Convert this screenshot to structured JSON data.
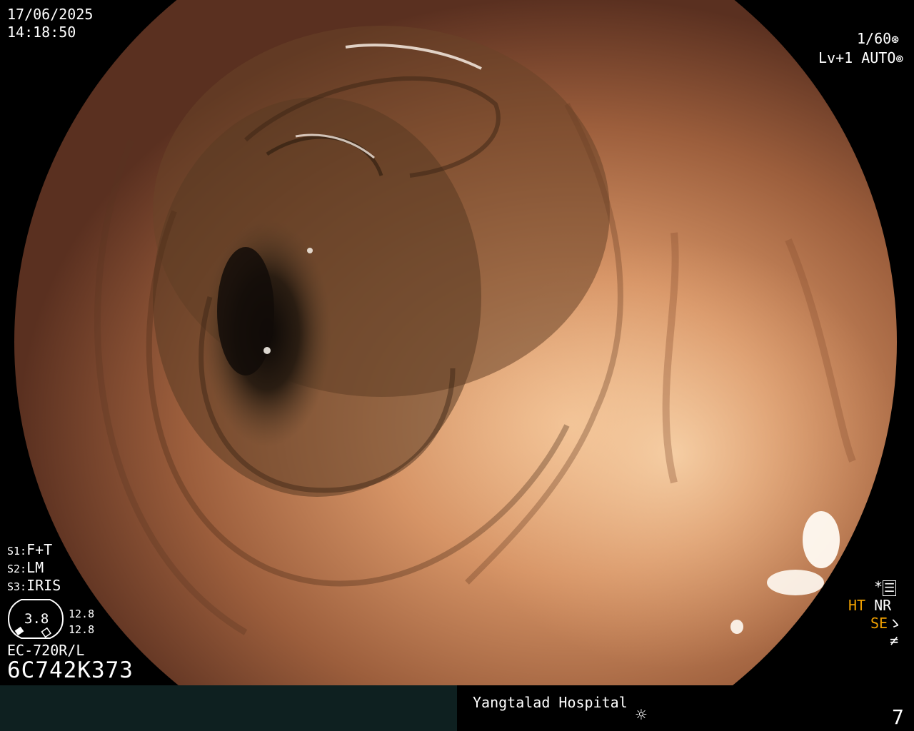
{
  "overlay": {
    "date": "17/06/2025",
    "time": "14:18:50",
    "shutter": "1/60",
    "level": "Lv+1",
    "iris_mode": "AUTO",
    "settings": [
      {
        "key": "S1:",
        "value": "F+T"
      },
      {
        "key": "S2:",
        "value": "LM"
      },
      {
        "key": "S3:",
        "value": "IRIS"
      }
    ],
    "gauge_value": "3.8",
    "gauge_top": "12.8",
    "gauge_bottom": "12.8",
    "scope_model": "EC-720R/L",
    "scope_serial": "6C742K373",
    "star": "*",
    "ht_label": "HT",
    "nr_label": "NR",
    "se_label": "SE",
    "not_equal": "≠"
  },
  "footer": {
    "hospital": "Yangtalad Hospital",
    "page_number": "7",
    "brightness_icon": "sun-icon"
  },
  "colors": {
    "osd_text": "#ffffff",
    "accent_orange": "#f0a000",
    "footer_bg": "#0e2020",
    "mucosa": "#b0704a"
  }
}
